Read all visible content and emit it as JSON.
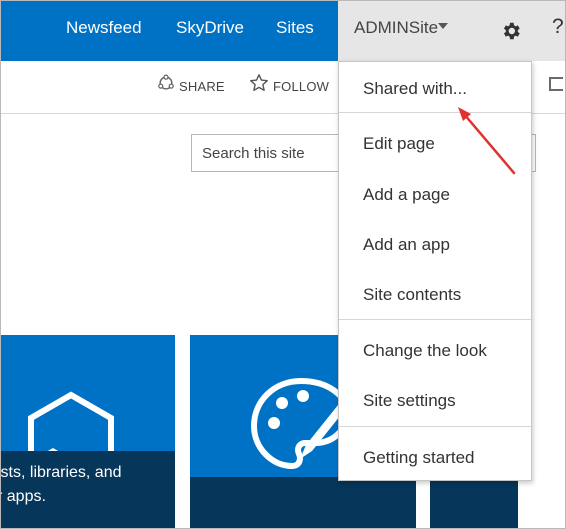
{
  "nav": {
    "newsfeed": "Newsfeed",
    "skydrive": "SkyDrive",
    "sites": "Sites",
    "admin": "ADMINSite",
    "help": "?"
  },
  "toolbar": {
    "share": "SHARE",
    "follow": "FOLLOW"
  },
  "search": {
    "placeholder": "Search this site"
  },
  "tiles": {
    "caption_line1": "ists, libraries, and",
    "caption_line2": "r apps."
  },
  "menu": {
    "items": [
      "Shared with...",
      "Edit page",
      "Add a page",
      "Add an app",
      "Site contents",
      "Change the look",
      "Site settings",
      "Getting started"
    ]
  },
  "colors": {
    "suitebar": "#0072c6",
    "tile_caption": "#06365a",
    "arrow": "#e0312f"
  },
  "icons": {
    "settings": "gear-icon",
    "share": "share-icon",
    "follow": "star-icon",
    "caret": "caret-down-icon",
    "focus": "focus-icon"
  }
}
